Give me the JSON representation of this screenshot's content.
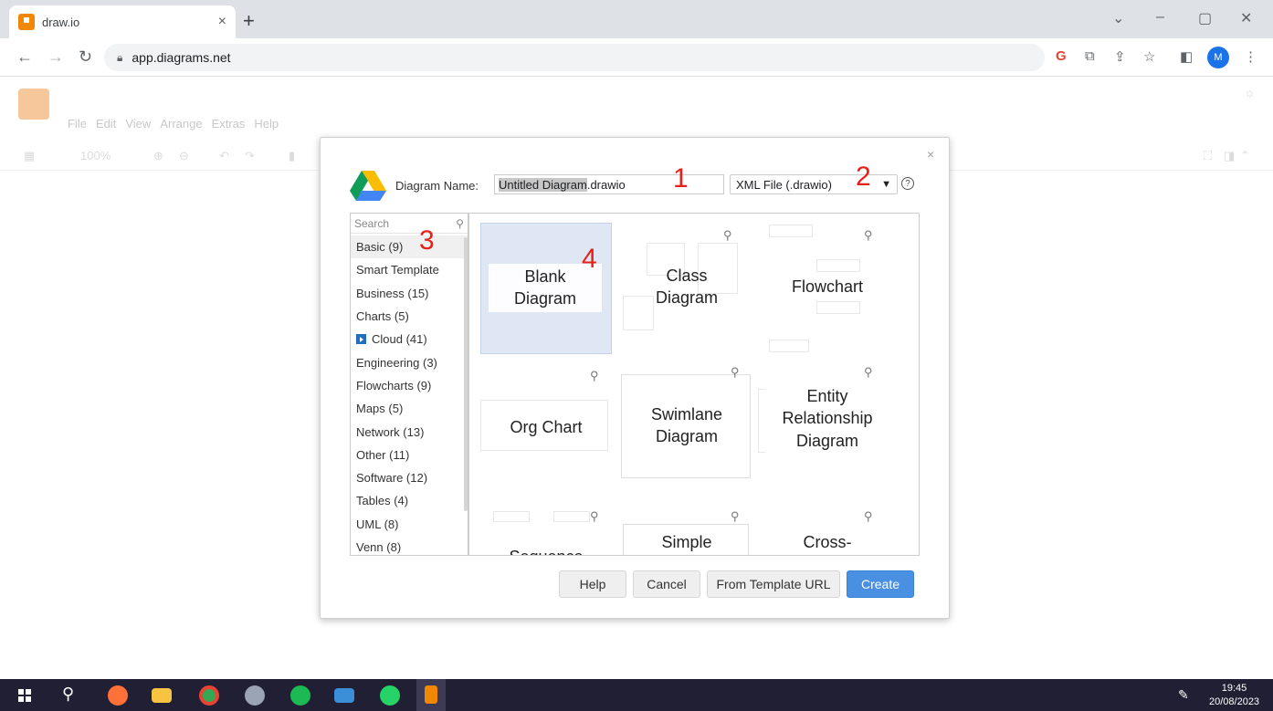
{
  "browser": {
    "tab_title": "draw.io",
    "tab_close": "×",
    "new_tab": "+",
    "url": "app.diagrams.net",
    "profile_initial": "M",
    "window_controls": [
      "⌄",
      "–",
      "▢",
      "✕"
    ]
  },
  "app": {
    "menu": [
      "File",
      "Edit",
      "View",
      "Arrange",
      "Extras",
      "Help"
    ],
    "zoom": "100%"
  },
  "dialog": {
    "close": "×",
    "name_label": "Diagram Name:",
    "name_selected": "Untitled Diagram",
    "name_ext": ".drawio",
    "format": "XML File (.drawio)",
    "help_glyph": "?",
    "search_placeholder": "Search",
    "categories": [
      "Basic (9)",
      "Smart Template",
      "Business (15)",
      "Charts (5)",
      "Cloud (41)",
      "Engineering (3)",
      "Flowcharts (9)",
      "Maps (5)",
      "Network (13)",
      "Other (11)",
      "Software (12)",
      "Tables (4)",
      "UML (8)",
      "Venn (8)"
    ],
    "templates": [
      "Blank Diagram",
      "Class Diagram",
      "Flowchart",
      "Org Chart",
      "Swimlane Diagram",
      "Entity Relationship Diagram",
      "Sequence",
      "Simple",
      "Cross-"
    ],
    "buttons": {
      "help": "Help",
      "cancel": "Cancel",
      "from_url": "From Template URL",
      "create": "Create"
    }
  },
  "annotations": [
    "1",
    "2",
    "3",
    "4"
  ],
  "taskbar": {
    "time": "19:45",
    "date": "20/08/2023"
  }
}
